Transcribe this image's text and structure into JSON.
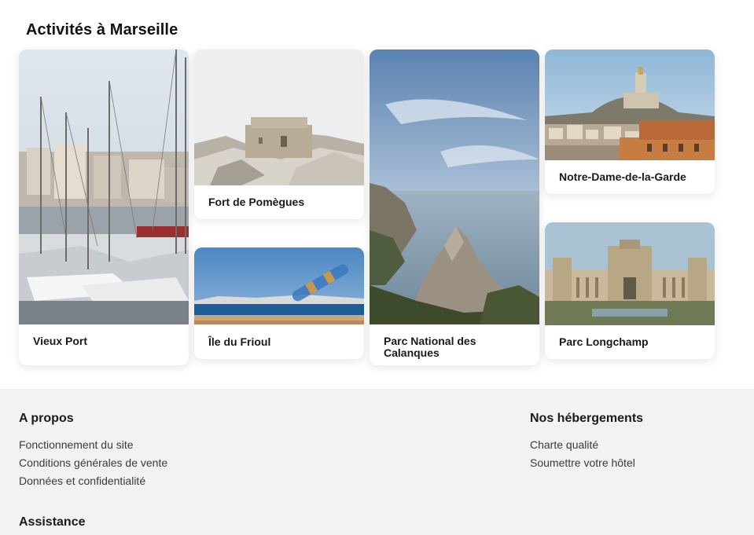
{
  "section": {
    "title": "Activités à Marseille"
  },
  "cards": [
    {
      "label": "Vieux Port"
    },
    {
      "label": "Fort de Pomègues"
    },
    {
      "label": "Île du Frioul"
    },
    {
      "label": "Parc National des Calanques"
    },
    {
      "label": "Notre-Dame-de-la-Garde"
    },
    {
      "label": "Parc Longchamp"
    }
  ],
  "footer": {
    "about": {
      "title": "A propos",
      "links": [
        "Fonctionnement du site",
        "Conditions générales de vente",
        "Données et confidentialité"
      ]
    },
    "accommodations": {
      "title": "Nos hébergements",
      "links": [
        "Charte qualité",
        "Soumettre votre hôtel"
      ]
    },
    "assistance": {
      "title": "Assistance"
    }
  }
}
